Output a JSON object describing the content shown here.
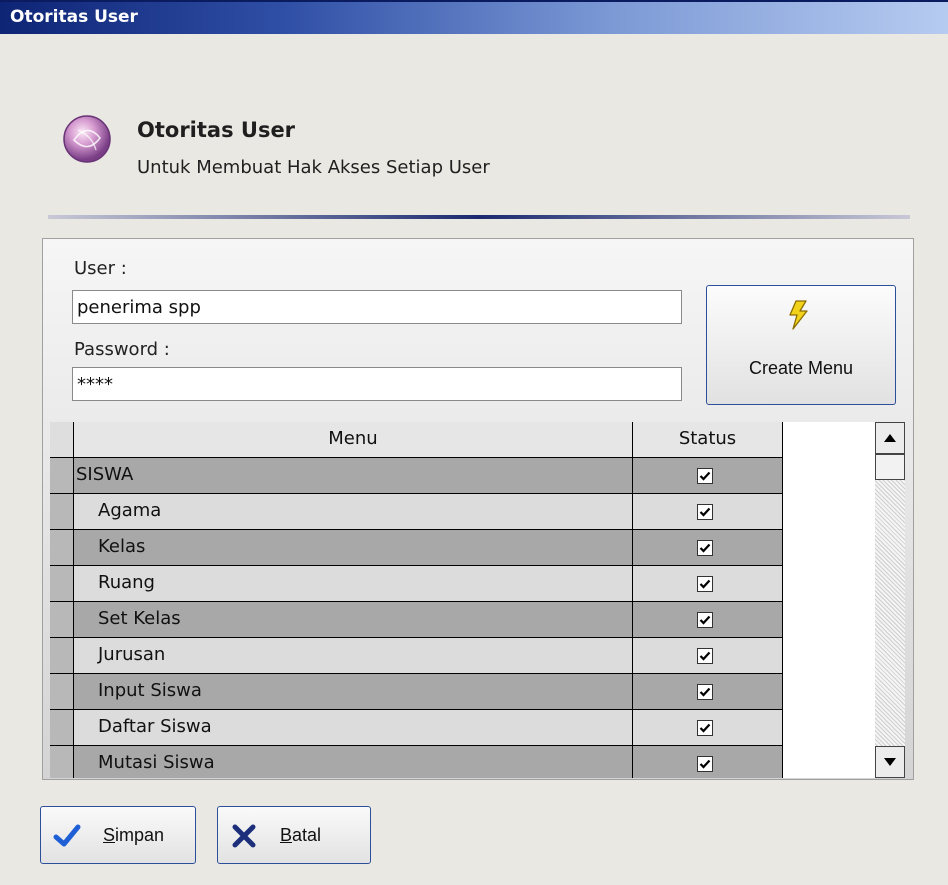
{
  "window": {
    "title": "Otoritas User"
  },
  "header": {
    "icon": "purple-orb-icon",
    "title": "Otoritas User",
    "subtitle": "Untuk Membuat Hak Akses Setiap User"
  },
  "form": {
    "user_label": "User :",
    "user_value": "penerima spp",
    "password_label": "Password :",
    "password_value": "****",
    "create_menu_label": "Create Menu",
    "create_menu_icon": "lightning-bolt-icon"
  },
  "grid": {
    "columns": [
      "Menu",
      "Status"
    ],
    "rows": [
      {
        "menu": "SISWA",
        "checked": true
      },
      {
        "menu": "Agama",
        "checked": true
      },
      {
        "menu": "Kelas",
        "checked": true
      },
      {
        "menu": "Ruang",
        "checked": true
      },
      {
        "menu": "Set Kelas",
        "checked": true
      },
      {
        "menu": "Jurusan",
        "checked": true
      },
      {
        "menu": "Input Siswa",
        "checked": true
      },
      {
        "menu": "Daftar Siswa",
        "checked": true
      },
      {
        "menu": "Mutasi Siswa",
        "checked": true
      }
    ]
  },
  "buttons": {
    "save_label": "Simpan",
    "save_accel": "S",
    "save_rest": "impan",
    "save_icon": "check-icon",
    "cancel_label": "Batal",
    "cancel_accel": "B",
    "cancel_rest": "atal",
    "cancel_icon": "x-icon"
  },
  "colors": {
    "check_blue": "#1f5fd6",
    "x_navy": "#1b2f7a",
    "bolt_yellow": "#f2d21a"
  }
}
